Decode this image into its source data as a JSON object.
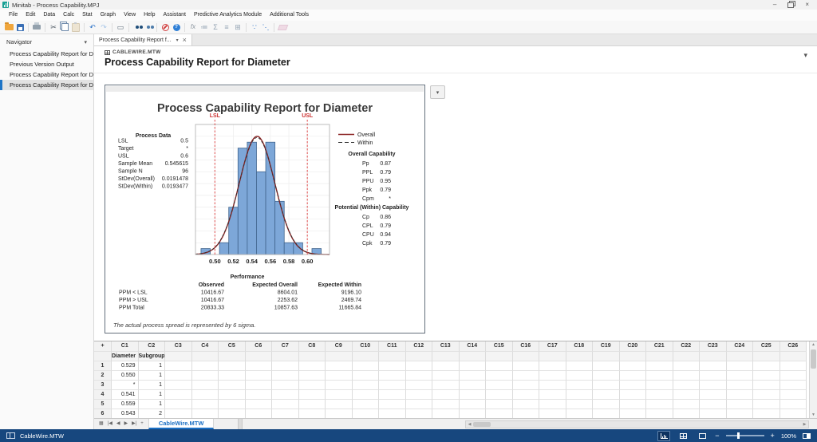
{
  "window": {
    "title": "Minitab - Process Capability.MPJ",
    "minimize_glyph": "–",
    "close_glyph": "×"
  },
  "menu_bar": {
    "items": [
      "File",
      "Edit",
      "Data",
      "Calc",
      "Stat",
      "Graph",
      "View",
      "Help",
      "Assistant",
      "Predictive Analytics Module",
      "Additional Tools"
    ]
  },
  "toolbar": {
    "icons": [
      {
        "name": "open-project-icon",
        "kind": "folder"
      },
      {
        "name": "save-project-icon",
        "kind": "floppy"
      },
      {
        "name": "sep1",
        "kind": "sep"
      },
      {
        "name": "print-icon",
        "kind": "printer"
      },
      {
        "name": "sep2",
        "kind": "sep"
      },
      {
        "name": "cut-icon",
        "kind": "glyph",
        "glyph": "✂",
        "color": "#4a5560"
      },
      {
        "name": "copy-icon",
        "kind": "copy"
      },
      {
        "name": "paste-icon",
        "kind": "paste",
        "disabled": true
      },
      {
        "name": "sep3",
        "kind": "sep"
      },
      {
        "name": "undo-icon",
        "kind": "glyph",
        "glyph": "↶",
        "color": "#2e74c9"
      },
      {
        "name": "redo-icon",
        "kind": "glyph",
        "glyph": "↷",
        "color": "#a9c7e8"
      },
      {
        "name": "sep4",
        "kind": "sep"
      },
      {
        "name": "new-graph-window-icon",
        "kind": "glyph",
        "glyph": "▭",
        "color": "#5a6a78"
      },
      {
        "name": "sep5",
        "kind": "sep"
      },
      {
        "name": "find-icon",
        "kind": "binoculars",
        "color": "#1f4e79"
      },
      {
        "name": "find-next-icon",
        "kind": "binoculars",
        "color": "#4f7dab"
      },
      {
        "name": "sep6",
        "kind": "sep"
      },
      {
        "name": "stop-icon",
        "kind": "stop"
      },
      {
        "name": "help-icon",
        "kind": "help"
      },
      {
        "name": "sep7",
        "kind": "sep"
      },
      {
        "name": "insert-function-icon",
        "kind": "glyph",
        "glyph": "fx",
        "color": "#8a949e",
        "italic": true
      },
      {
        "name": "assign-formula-icon",
        "kind": "glyph",
        "glyph": "≔",
        "color": "#93a3b3"
      },
      {
        "name": "column-statistics-icon",
        "kind": "glyph",
        "glyph": "Σ",
        "color": "#93a3b3"
      },
      {
        "name": "session-commands-icon",
        "kind": "glyph",
        "glyph": "≡",
        "color": "#93a3b3"
      },
      {
        "name": "subset-worksheet-icon",
        "kind": "glyph",
        "glyph": "⊞",
        "color": "#93a3b3"
      },
      {
        "name": "sep8",
        "kind": "sep"
      },
      {
        "name": "scatterplot-icon",
        "kind": "glyph",
        "glyph": "∵",
        "color": "#2e74c9"
      },
      {
        "name": "fitted-line-icon",
        "kind": "glyph",
        "glyph": "⋱",
        "color": "#2e74c9"
      },
      {
        "name": "sep9",
        "kind": "sep"
      },
      {
        "name": "brush-icon",
        "kind": "eraser",
        "disabled": true
      }
    ]
  },
  "navigator": {
    "title": "Navigator",
    "items": [
      {
        "label": "Process Capability Report for Di...",
        "selected": false
      },
      {
        "label": "Previous Version Output",
        "selected": false
      },
      {
        "label": "Process Capability Report for Di...",
        "selected": false
      },
      {
        "label": "Process Capability Report for Di...",
        "selected": true
      }
    ]
  },
  "content_tabs": [
    {
      "label": "Process Capability Report f...",
      "active": true
    }
  ],
  "output": {
    "worksheet_ref": "CABLEWIRE.MTW",
    "page_title": "Process Capability Report for Diameter"
  },
  "chart_data": {
    "type": "histogram",
    "title": "Process Capability Report for Diameter",
    "xlim": [
      0.479,
      0.624
    ],
    "ylim": [
      0,
      22
    ],
    "xticks": [
      0.5,
      0.52,
      0.54,
      0.56,
      0.58,
      0.6
    ],
    "xtick_labels": [
      "0.50",
      "0.52",
      "0.54",
      "0.56",
      "0.58",
      "0.60"
    ],
    "grid": true,
    "bins": {
      "width": 0.01,
      "centers": [
        0.49,
        0.5,
        0.51,
        0.52,
        0.53,
        0.54,
        0.55,
        0.56,
        0.57,
        0.58,
        0.59,
        0.6,
        0.61
      ],
      "counts": [
        1,
        0,
        2,
        8,
        18,
        19,
        14,
        19,
        9,
        2,
        2,
        0,
        1
      ]
    },
    "sample_n": 96,
    "spec_limits": {
      "lsl": {
        "label": "LSL",
        "value": 0.5
      },
      "usl": {
        "label": "USL",
        "value": 0.6
      }
    },
    "curves": [
      {
        "name": "Overall",
        "mean": 0.545615,
        "stdev": 0.0191478,
        "style": "solid",
        "color": "#8b2525"
      },
      {
        "name": "Within",
        "mean": 0.545615,
        "stdev": 0.0193477,
        "style": "dashed",
        "color": "#303030"
      }
    ],
    "legend": {
      "position": "right",
      "entries": [
        "Overall",
        "Within"
      ]
    },
    "process_data": {
      "title": "Process Data",
      "rows": [
        [
          "LSL",
          "0.5"
        ],
        [
          "Target",
          "*"
        ],
        [
          "USL",
          "0.6"
        ],
        [
          "Sample Mean",
          "0.545615"
        ],
        [
          "Sample N",
          "96"
        ],
        [
          "StDev(Overall)",
          "0.0191478"
        ],
        [
          "StDev(Within)",
          "0.0193477"
        ]
      ]
    },
    "overall_capability": {
      "title": "Overall Capability",
      "rows": [
        [
          "Pp",
          "0.87"
        ],
        [
          "PPL",
          "0.79"
        ],
        [
          "PPU",
          "0.95"
        ],
        [
          "Ppk",
          "0.79"
        ],
        [
          "Cpm",
          "*"
        ]
      ]
    },
    "within_capability": {
      "title": "Potential (Within) Capability",
      "rows": [
        [
          "Cp",
          "0.86"
        ],
        [
          "CPL",
          "0.79"
        ],
        [
          "CPU",
          "0.94"
        ],
        [
          "Cpk",
          "0.79"
        ]
      ]
    },
    "performance": {
      "title": "Performance",
      "columns": [
        "Observed",
        "Expected Overall",
        "Expected Within"
      ],
      "rows": [
        [
          "PPM < LSL",
          "10416.67",
          "8604.01",
          "9196.10"
        ],
        [
          "PPM > USL",
          "10416.67",
          "2253.62",
          "2469.74"
        ],
        [
          "PPM Total",
          "20833.33",
          "10857.63",
          "11665.84"
        ]
      ]
    },
    "footnote": "The actual process spread is represented by 6 sigma."
  },
  "worksheet": {
    "corner": "+",
    "columns": [
      "C1",
      "C2",
      "C3",
      "C4",
      "C5",
      "C6",
      "C7",
      "C8",
      "C9",
      "C10",
      "C11",
      "C12",
      "C13",
      "C14",
      "C15",
      "C16",
      "C17",
      "C18",
      "C19",
      "C20",
      "C21",
      "C22",
      "C23",
      "C24",
      "C25",
      "C26"
    ],
    "column_names": {
      "C1": "Diameter",
      "C2": "Subgroup"
    },
    "rows": [
      {
        "num": "1",
        "cells": [
          "0.529",
          "1"
        ]
      },
      {
        "num": "2",
        "cells": [
          "0.550",
          "1"
        ]
      },
      {
        "num": "3",
        "cells": [
          "*",
          "1"
        ]
      },
      {
        "num": "4",
        "cells": [
          "0.541",
          "1"
        ]
      },
      {
        "num": "5",
        "cells": [
          "0.559",
          "1"
        ]
      },
      {
        "num": "6",
        "cells": [
          "0.543",
          "2"
        ]
      }
    ],
    "nav_icons": [
      {
        "name": "worksheet-list-icon",
        "glyph": "▦"
      },
      {
        "name": "first-worksheet-icon",
        "glyph": "|◀"
      },
      {
        "name": "previous-worksheet-icon",
        "glyph": "◀"
      },
      {
        "name": "next-worksheet-icon",
        "glyph": "▶"
      },
      {
        "name": "last-worksheet-icon",
        "glyph": "▶|"
      },
      {
        "name": "add-worksheet-icon",
        "glyph": "+"
      }
    ],
    "active_tab": "CableWire.MTW"
  },
  "status_bar": {
    "worksheet": "CableWire.MTW",
    "zoom_level": "100%"
  },
  "colors": {
    "accent_blue": "#1d74c6",
    "statusbar_blue": "#17477e",
    "bar_fill": "#7da7d8",
    "bar_stroke": "#41658e",
    "spec_line_red": "#e25d5d",
    "overall_curve": "#8b2525"
  }
}
